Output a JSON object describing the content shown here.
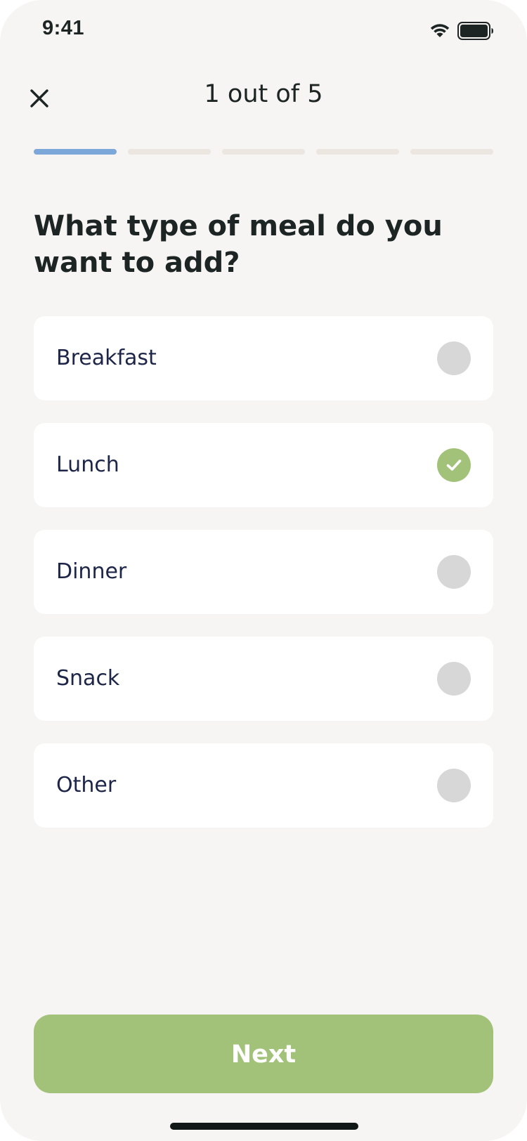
{
  "status_bar": {
    "time": "9:41",
    "icons": [
      "wifi-icon",
      "battery-icon"
    ]
  },
  "header": {
    "close_icon": "close-icon",
    "step_title": "1 out of 5"
  },
  "progress": {
    "total_steps": 5,
    "current_step": 1,
    "active_color": "#7ba7d9",
    "inactive_color": "#ebe6e0"
  },
  "question": "What type of meal do you want to add?",
  "options": [
    {
      "label": "Breakfast",
      "selected": false
    },
    {
      "label": "Lunch",
      "selected": true
    },
    {
      "label": "Dinner",
      "selected": false
    },
    {
      "label": "Snack",
      "selected": false
    },
    {
      "label": "Other",
      "selected": false
    }
  ],
  "next_button": {
    "label": "Next",
    "color": "#a3c279"
  },
  "colors": {
    "background": "#f6f5f3",
    "accent": "#a3c279",
    "radio_unselected": "#d7d7d7",
    "text_dark": "#1d2424"
  }
}
